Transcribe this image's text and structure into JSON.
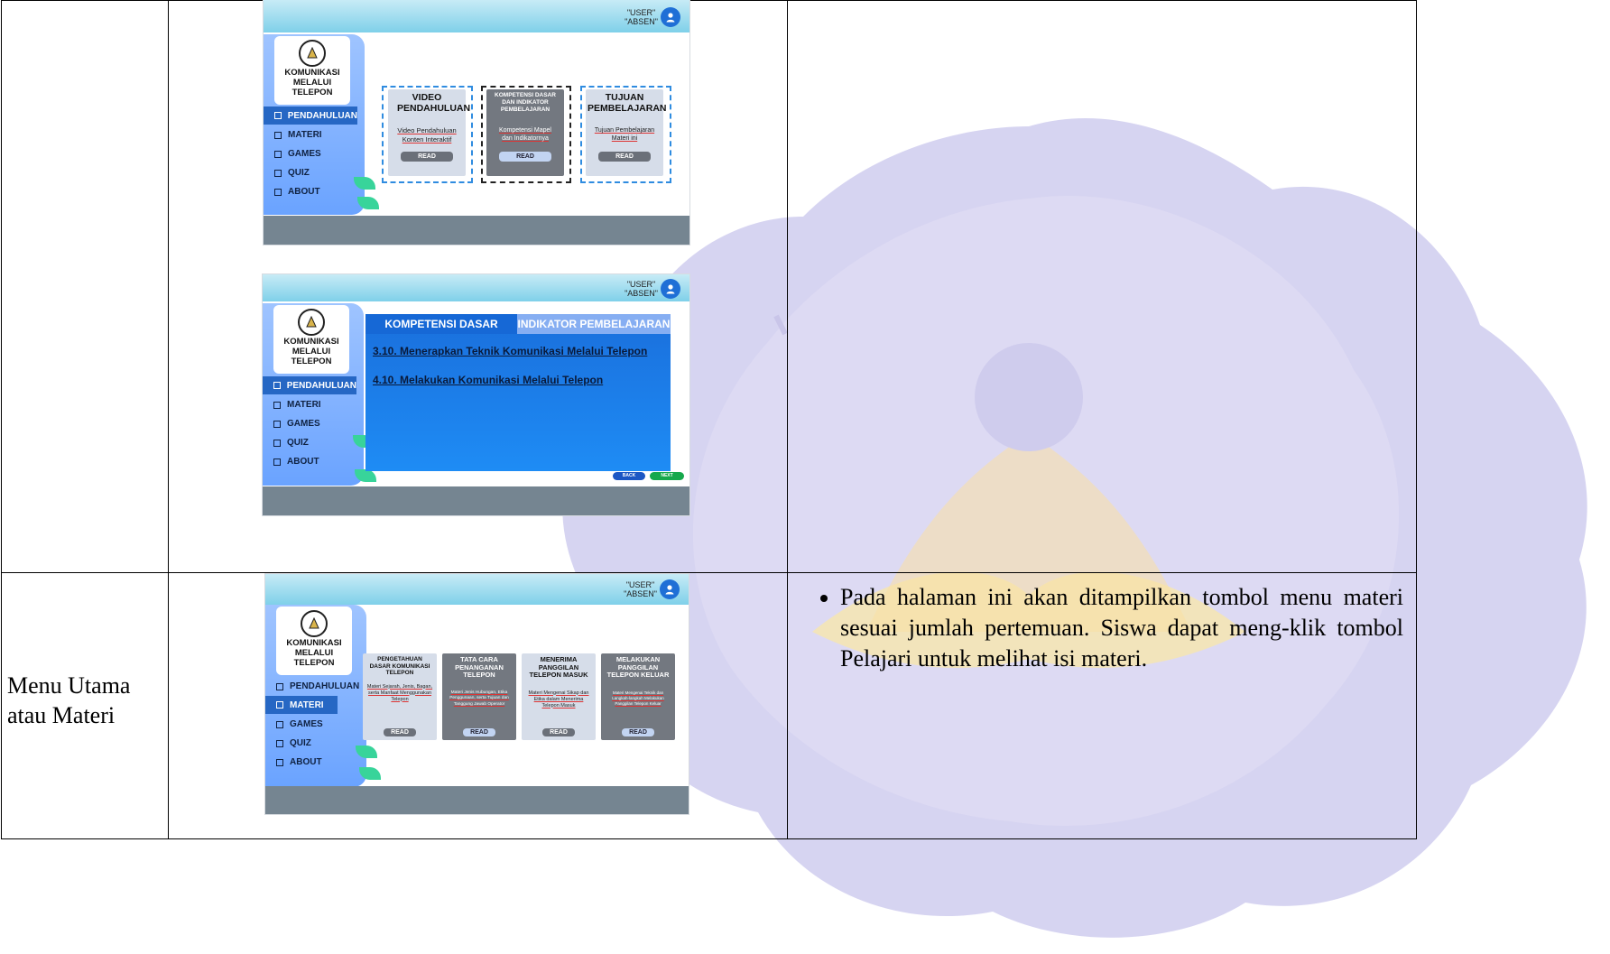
{
  "row_labels": {
    "row2_line1": "Menu Utama",
    "row2_line2": "atau Materi"
  },
  "row2_description": "Pada halaman ini akan ditampilkan tombol menu materi sesuai jumlah pertemuan. Siswa dapat meng-klik tombol Pelajari untuk melihat isi materi.",
  "app": {
    "user_line1": "\"USER\"",
    "user_line2": "\"ABSEN\"",
    "logo_lines": [
      "KOMUNIKASI",
      "MELALUI",
      "TELEPON"
    ],
    "menu": [
      "PENDAHULUAN",
      "MATERI",
      "GAMES",
      "QUIZ",
      "ABOUT"
    ],
    "read_label": "READ"
  },
  "screen1": {
    "active_menu": "PENDAHULUAN",
    "cards": [
      {
        "title": "VIDEO PENDAHULUAN",
        "desc": "Video Pendahuluan Konten Interaktif",
        "style": "light"
      },
      {
        "title": "KOMPETENSI DASAR DAN INDIKATOR PEMBELAJARAN",
        "desc": "Kompetensi Mapel dan Indikatornya",
        "style": "dark"
      },
      {
        "title": "TUJUAN PEMBELAJARAN",
        "desc": "Tujuan Pembelajaran Materi ini",
        "style": "light"
      }
    ]
  },
  "screen2": {
    "active_menu": "PENDAHULUAN",
    "tab_active": "KOMPETENSI DASAR",
    "tab_inactive": "INDIKATOR PEMBELAJARAN",
    "lines": [
      "3.10. Menerapkan Teknik Komunikasi Melalui Telepon",
      "4.10. Melakukan Komunikasi Melalui Telepon"
    ],
    "back_label": "BACK",
    "next_label": "NEXT"
  },
  "screen3": {
    "active_menu": "MATERI",
    "cards": [
      {
        "title": "PENGETAHUAN DASAR KOMUNIKASI TELEPON",
        "desc": "Materi Sejarah, Jenis, Bagan, serta Manfaat Menggunakan Telepon",
        "style": "light"
      },
      {
        "title": "TATA CARA PENANGANAN TELEPON",
        "desc": "Materi Jenis Hubungan, Etika Penggunaan, serta Tujuan dan Tanggung Jawab Operator",
        "style": "dark"
      },
      {
        "title": "MENERIMA PANGGILAN TELEPON MASUK",
        "desc": "Materi Mengenai Sikap dan Etika dalam Menerima Telepon Masuk",
        "style": "light"
      },
      {
        "title": "MELAKUKAN PANGGILAN TELEPON KELUAR",
        "desc": "Materi Mengenai Teknik dan Langkah-langkah Melakukan Panggilan Telepon Keluar",
        "style": "dark"
      }
    ]
  },
  "colors": {
    "sidebar": "#7fb0ff",
    "active_menu": "#2667c4",
    "topbar": "#8fd6ee",
    "bottombar": "#758591",
    "panel_blue": "#1a7ae8"
  }
}
